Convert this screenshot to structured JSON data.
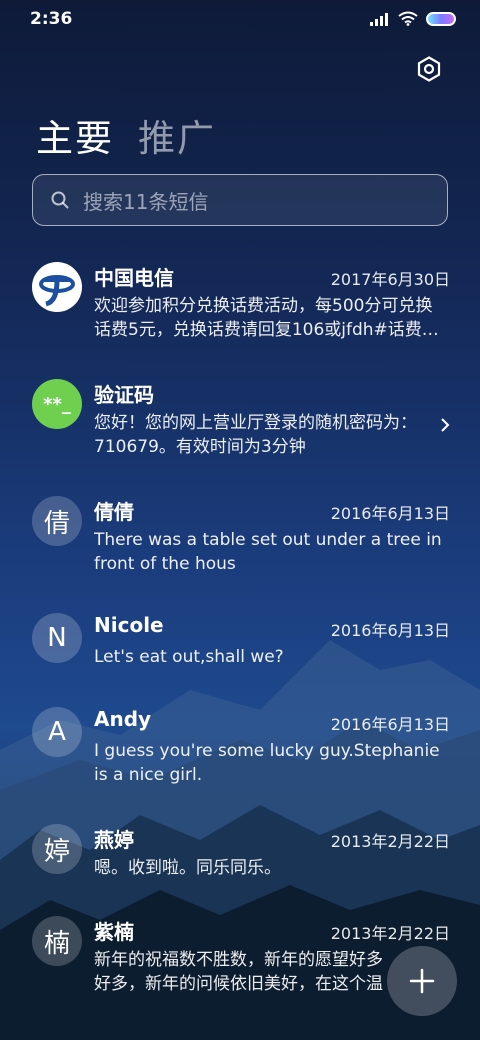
{
  "status": {
    "time": "2:36"
  },
  "header": {
    "tab_primary": "主要",
    "tab_secondary": "推广"
  },
  "search": {
    "placeholder": "搜索11条短信"
  },
  "messages": [
    {
      "name": "中国电信",
      "date": "2017年6月30日",
      "text": "欢迎参加积分兑换话费活动，每500分可兑换话费5元，兑换话费请回复106或jfdh#话费…",
      "avatar": "",
      "avatar_color": "#ffffff"
    },
    {
      "name": "验证码",
      "date": "",
      "text": "您好！您的网上营业厅登录的随机密码为：710679。有效时间为3分钟",
      "avatar": "**_",
      "avatar_color": "#6fcf4f"
    },
    {
      "name": "倩倩",
      "date": "2016年6月13日",
      "text": "There was a table set out under a tree in front of the hous",
      "avatar": "倩"
    },
    {
      "name": "Nicole",
      "date": "2016年6月13日",
      "text": "Let's eat out,shall we?",
      "avatar": "N"
    },
    {
      "name": "Andy",
      "date": "2016年6月13日",
      "text": "I guess you're some lucky guy.Stephanie is a nice girl.",
      "avatar": "A"
    },
    {
      "name": "燕婷",
      "date": "2013年2月22日",
      "text": "嗯。收到啦。同乐同乐。",
      "avatar": "婷"
    },
    {
      "name": "紫楠",
      "date": "2013年2月22日",
      "text": "新年的祝福数不胜数，新年的愿望好多好多，新年的问候依旧美好，在这个温馨的时刻",
      "avatar": "楠"
    }
  ],
  "colors": {
    "accent": "#ffffff",
    "telecom_blue": "#1d4fa0",
    "verify_green": "#6fcf4f"
  },
  "icons": {
    "settings": "hexagon-settings-icon",
    "search": "search-icon",
    "compose": "plus-icon"
  }
}
